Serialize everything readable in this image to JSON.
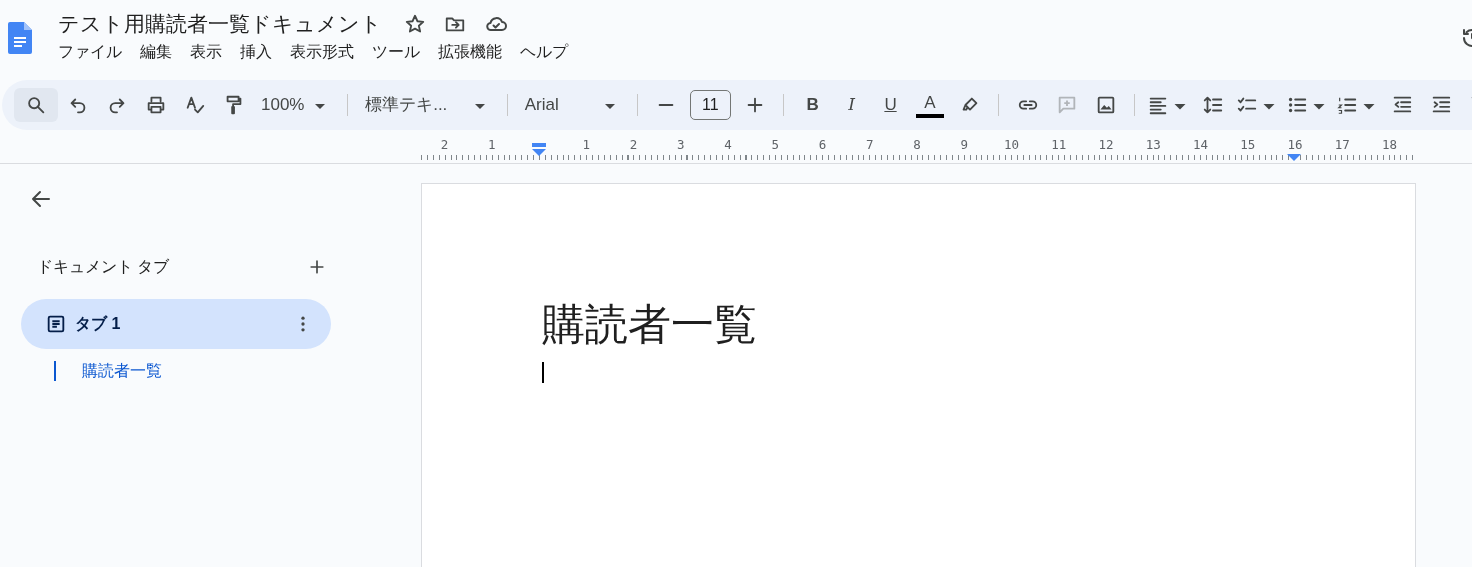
{
  "document_title": "テスト用購読者一覧ドキュメント",
  "menu": [
    "ファイル",
    "編集",
    "表示",
    "挿入",
    "表示形式",
    "ツール",
    "拡張機能",
    "ヘルプ"
  ],
  "toolbar": {
    "zoom": "100%",
    "style": "標準テキ...",
    "font": "Arial",
    "font_size": "11",
    "bold": "B",
    "italic": "I",
    "underline": "U",
    "text_color": "A"
  },
  "ruler": {
    "left_numbers": [
      "2",
      "1"
    ],
    "right_numbers": [
      "1",
      "2",
      "3",
      "4",
      "5",
      "6",
      "7",
      "8",
      "9",
      "10",
      "11",
      "12",
      "13",
      "14",
      "15",
      "16",
      "17",
      "18"
    ]
  },
  "sidebar": {
    "heading": "ドキュメント タブ",
    "tabs": [
      {
        "label": "タブ 1",
        "selected": true,
        "children": [
          {
            "label": "購読者一覧"
          }
        ]
      }
    ]
  },
  "page": {
    "heading": "購読者一覧"
  }
}
